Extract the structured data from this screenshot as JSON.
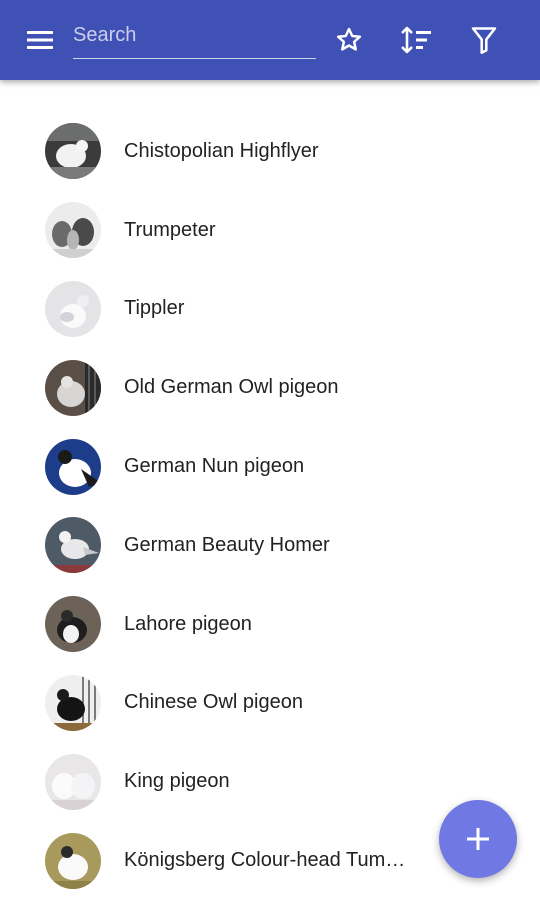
{
  "header": {
    "search": {
      "placeholder": "Search",
      "value": ""
    },
    "icons": [
      "menu-icon",
      "star-icon",
      "sort-icon",
      "filter-icon"
    ],
    "color": "#3f51b5"
  },
  "breeds": [
    {
      "name": "Chistopolian Highflyer"
    },
    {
      "name": "Trumpeter"
    },
    {
      "name": "Tippler"
    },
    {
      "name": "Old German Owl pigeon"
    },
    {
      "name": "German Nun pigeon"
    },
    {
      "name": "German Beauty Homer"
    },
    {
      "name": "Lahore pigeon"
    },
    {
      "name": "Chinese Owl pigeon"
    },
    {
      "name": "King pigeon"
    },
    {
      "name": "Königsberg Colour-head Tumbler"
    }
  ],
  "fab": {
    "icon": "plus-icon",
    "color": "#6f78e3"
  }
}
